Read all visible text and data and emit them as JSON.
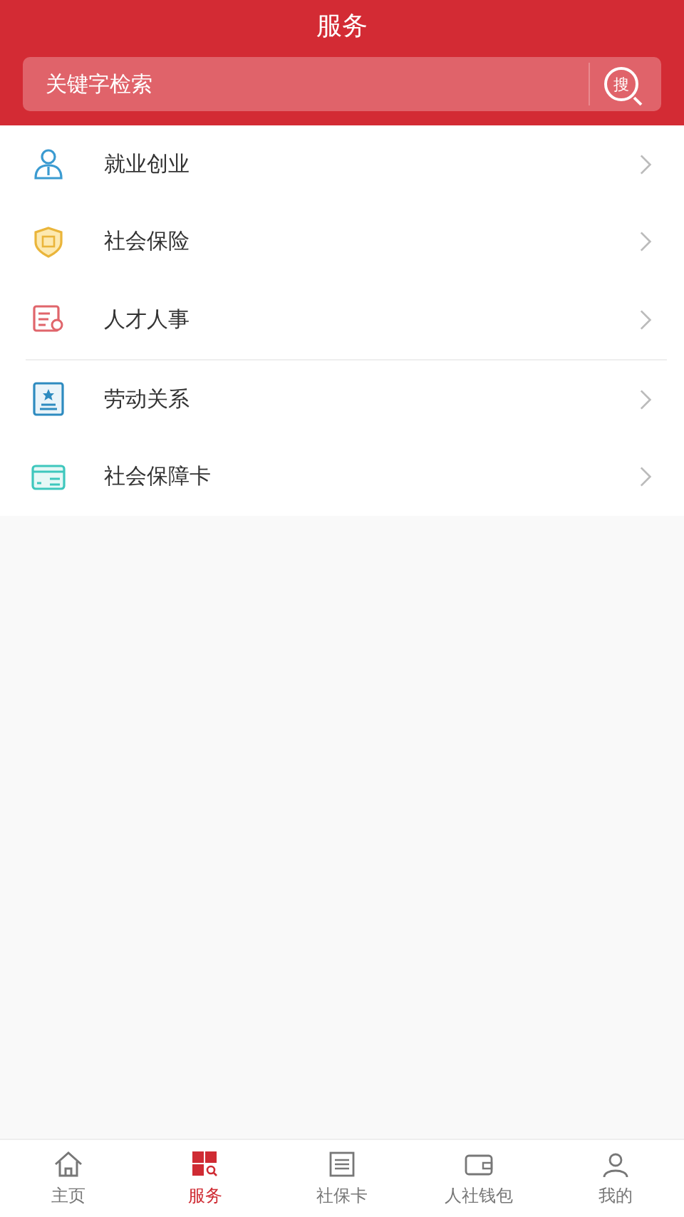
{
  "header": {
    "title": "服务"
  },
  "search": {
    "placeholder": "关键字检索",
    "button": "搜"
  },
  "services": [
    {
      "label": "就业创业",
      "kind": "person"
    },
    {
      "label": "社会保险",
      "kind": "shield"
    },
    {
      "label": "人才人事",
      "kind": "certificate"
    },
    {
      "label": "劳动关系",
      "kind": "badge"
    },
    {
      "label": "社会保障卡",
      "kind": "card"
    }
  ],
  "tabs": [
    {
      "label": "主页",
      "kind": "home",
      "selected": false
    },
    {
      "label": "服务",
      "kind": "grid",
      "selected": true
    },
    {
      "label": "社保卡",
      "kind": "doc",
      "selected": false
    },
    {
      "label": "人社钱包",
      "kind": "wallet",
      "selected": false
    },
    {
      "label": "我的",
      "kind": "user",
      "selected": false
    }
  ]
}
